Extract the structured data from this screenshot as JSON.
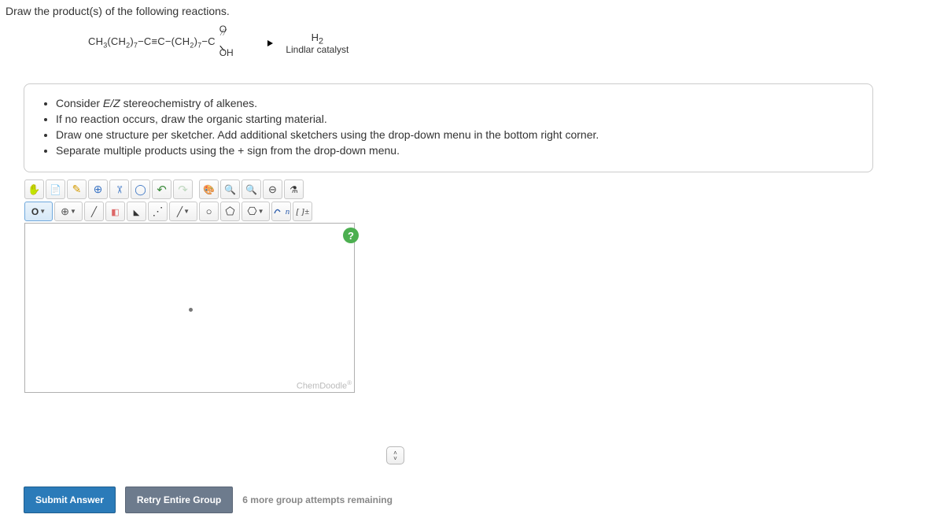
{
  "question": {
    "prompt": "Draw the product(s) of the following reactions."
  },
  "reaction": {
    "reactant_prefix": "CH",
    "reactant_sub1": "3",
    "reactant_mid1": "(CH",
    "reactant_sub2": "2",
    "reactant_mid2": ")",
    "reactant_sub3": "7",
    "reactant_mid3": "−C≡C−(CH",
    "reactant_sub4": "2",
    "reactant_mid4": ")",
    "reactant_sub5": "7",
    "reactant_end": "−C",
    "dbl_o": "O",
    "oh": "OH",
    "arrow_top_h": "H",
    "arrow_top_sub": "2",
    "arrow_bottom": "Lindlar catalyst"
  },
  "instructions": {
    "b1_a": "Consider ",
    "b1_em": "E/Z",
    "b1_b": " stereochemistry of alkenes.",
    "b2": "If no reaction occurs, draw the organic starting material.",
    "b3": "Draw one structure per sketcher. Add additional sketchers using the drop-down menu in the bottom right corner.",
    "b4": "Separate multiple products using the + sign from the drop-down menu."
  },
  "toolbar": {
    "element_label": "O",
    "sn_label": "n",
    "charge_label": "[ ]±"
  },
  "canvas": {
    "brand": "ChemDoodle",
    "reg": "®",
    "help": "?"
  },
  "footer": {
    "submit": "Submit Answer",
    "retry": "Retry Entire Group",
    "attempts": "6 more group attempts remaining"
  }
}
